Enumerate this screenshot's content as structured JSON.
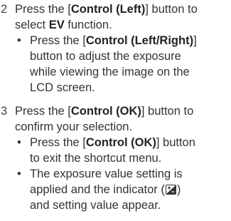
{
  "step2": {
    "number": "2",
    "line1_a": "Press the [",
    "line1_b": "Control (Left)",
    "line1_c": "] button to",
    "line2_a": "select ",
    "line2_b": "EV",
    "line2_c": " function.",
    "bullet1": {
      "line1_a": "Press the [",
      "line1_b": "Control (Left/Right)",
      "line1_c": "]",
      "line2": "button to adjust the exposure",
      "line3": "while viewing the image on the",
      "line4": "LCD screen."
    }
  },
  "step3": {
    "number": "3",
    "line1_a": "Press the [",
    "line1_b": "Control (OK)",
    "line1_c": "] button to",
    "line2": "confirm your selection.",
    "bullet1": {
      "line1_a": "Press the [",
      "line1_b": "Control (OK)",
      "line1_c": "] button",
      "line2": "to exit the shortcut menu."
    },
    "bullet2": {
      "line1": "The exposure value setting is",
      "line2": "applied and the indicator (",
      "line2_icon": "exposure-compensation-icon",
      "line2_after": ")",
      "line3": "and setting value appear."
    }
  },
  "bullet_glyph": "•"
}
